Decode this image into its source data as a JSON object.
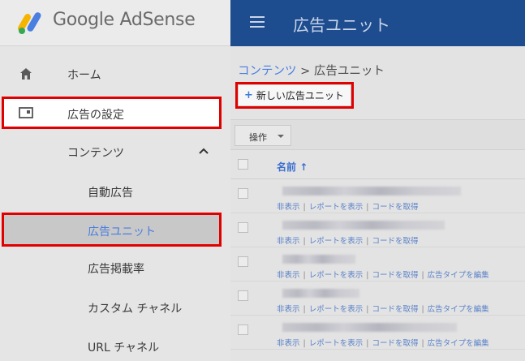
{
  "brand": {
    "name": "Google AdSense"
  },
  "sidebar": {
    "items": [
      {
        "label": "ホーム",
        "icon": "home-icon"
      },
      {
        "label": "広告の設定",
        "icon": "ad-settings-icon"
      },
      {
        "label": "コンテンツ",
        "icon": "chevron-up-icon"
      },
      {
        "label": "自動広告"
      },
      {
        "label": "広告ユニット"
      },
      {
        "label": "広告掲載率"
      },
      {
        "label": "カスタム チャネル"
      },
      {
        "label": "URL チャネル"
      }
    ]
  },
  "topbar": {
    "title": "広告ユニット"
  },
  "main": {
    "breadcrumb_parent": "コンテンツ",
    "breadcrumb_sep": " > ",
    "breadcrumb_current": "広告ユニット",
    "new_button": "新しい広告ユニット",
    "ops_button": "操作",
    "column_name": "名前",
    "rows": [
      {
        "links": [
          "非表示",
          "レポートを表示",
          "コードを取得"
        ]
      },
      {
        "links": [
          "非表示",
          "レポートを表示",
          "コードを取得"
        ]
      },
      {
        "links": [
          "非表示",
          "レポートを表示",
          "コードを取得",
          "広告タイプを編集"
        ]
      },
      {
        "links": [
          "非表示",
          "レポートを表示",
          "コードを取得",
          "広告タイプを編集"
        ]
      },
      {
        "links": [
          "非表示",
          "レポートを表示",
          "コードを取得",
          "広告タイプを編集"
        ]
      }
    ]
  },
  "colors": {
    "accent": "#4a7ee0",
    "topbar": "#1d4c8f",
    "highlight": "#e00000"
  }
}
